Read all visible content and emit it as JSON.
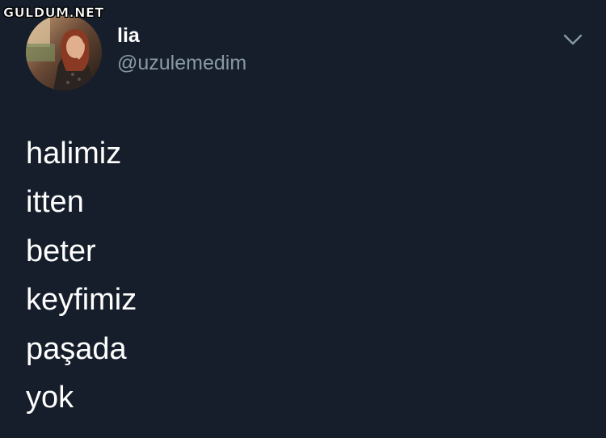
{
  "watermark": "GULDUM.NET",
  "tweet": {
    "author": {
      "display_name": "lia",
      "handle": "@uzulemedim",
      "avatar_icon": "profile-photo"
    },
    "menu_icon": "chevron-down-icon",
    "lines": [
      "halimiz",
      "itten",
      "beter",
      "keyfimiz",
      "paşada",
      "yok"
    ]
  },
  "colors": {
    "background": "#161e2b",
    "text_primary": "#ffffff",
    "text_secondary": "#8899a6"
  }
}
